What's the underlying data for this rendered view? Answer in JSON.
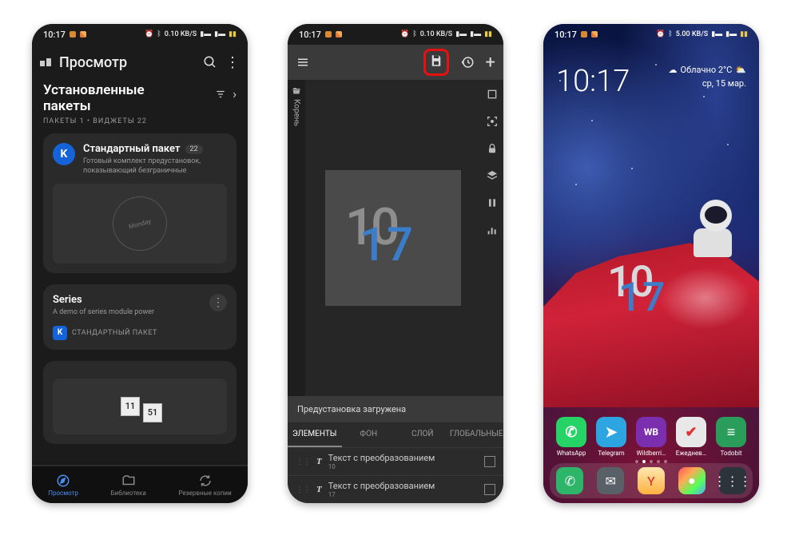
{
  "status": {
    "time": "10:17",
    "net_speed": "0.10 KB/S",
    "net_speed3": "5.00 KB/S"
  },
  "s1": {
    "page_title": "Просмотр",
    "section_title": "Установленные пакеты",
    "section_sub": "ПАКЕТЫ 1 • ВИДЖЕТЫ 22",
    "card1": {
      "title": "Стандартный пакет",
      "badge": "22",
      "desc": "Готовый комплект предустановок, показывающий безграничные"
    },
    "card2": {
      "title": "Series",
      "desc": "A demo of series module power",
      "tag": "СТАНДАРТНЫЙ ПАКЕТ"
    },
    "card3": {
      "num_a": "11",
      "num_b": "51"
    },
    "tabs": {
      "view": "Просмотр",
      "library": "Библиотека",
      "backups": "Резервные копии"
    }
  },
  "s2": {
    "side_label": "Корень",
    "snackbar": "Предустановка загружена",
    "tabs": {
      "elements": "ЭЛЕМЕНТЫ",
      "bg": "ФОН",
      "layer": "СЛОЙ",
      "global": "ГЛОБАЛЬНЫЕ"
    },
    "row_label": "Текст с преобразованием",
    "row1_sub": "10",
    "row2_sub": "17"
  },
  "s3": {
    "clock": "10:17",
    "weather_text": "Облачно 2°C",
    "date": "ср, 15 мар.",
    "apps": [
      {
        "name": "WhatsApp",
        "bg": "#25D366",
        "glyph": "✆"
      },
      {
        "name": "Telegram",
        "bg": "#2da5e1",
        "glyph": "➤"
      },
      {
        "name": "Wildberri…",
        "bg": "#7b2eae",
        "glyph": "WB"
      },
      {
        "name": "Ежеднев…",
        "bg": "#e8e8e8",
        "glyph": "✔",
        "fg": "#d33"
      },
      {
        "name": "Todobit",
        "bg": "#2a9d5a",
        "glyph": "≡"
      }
    ],
    "dock": [
      {
        "bg": "#2db56a",
        "glyph": "✆"
      },
      {
        "bg": "#5a6068",
        "glyph": "✉"
      },
      {
        "bg": "linear-gradient(#ffe9b0,#ffb040)",
        "glyph": "Y",
        "fg": "#d22"
      },
      {
        "bg": "linear-gradient(135deg,#f55,#fa5,#5f5,#5af)",
        "glyph": "●"
      },
      {
        "bg": "#2d333a",
        "glyph": "⋮⋮⋮"
      }
    ]
  }
}
